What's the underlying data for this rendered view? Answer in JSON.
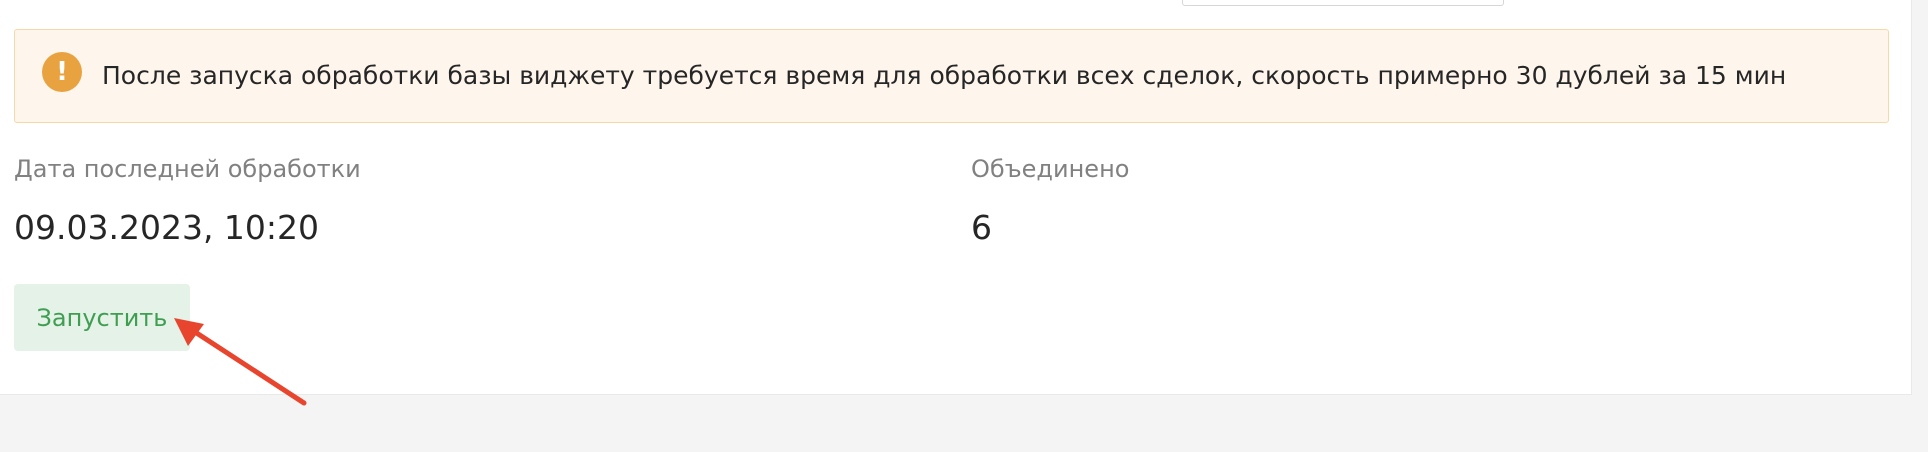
{
  "notice": {
    "icon": "exclamation-icon",
    "text": "После запуска обработки базы виджету требуется время для обработки всех сделок, скорость примерно 30 дублей за 15 мин",
    "background": "#fef6ec",
    "border": "#f6d9a8",
    "icon_color": "#e9a240"
  },
  "stats": {
    "last_processed_label": "Дата последней обработки",
    "last_processed_value": "09.03.2023, 10:20",
    "merged_label": "Объединено",
    "merged_value": "6"
  },
  "actions": {
    "run_label": "Запустить",
    "run_color": "#3f9e52",
    "run_background": "#e4f2e7"
  },
  "annotation": {
    "arrow_color": "#e8452e"
  }
}
